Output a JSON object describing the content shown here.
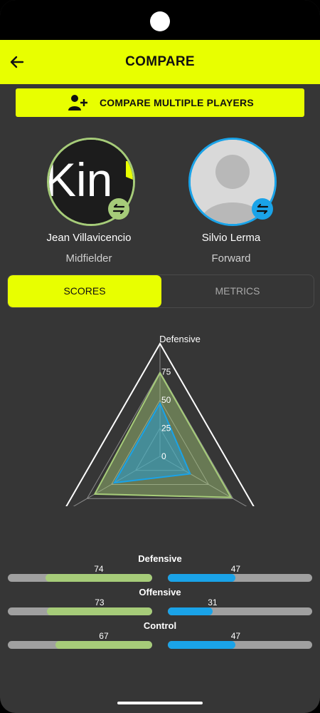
{
  "header": {
    "title": "COMPARE",
    "back_icon": "arrow-left-icon"
  },
  "compare_multiple": {
    "label": "COMPARE MULTIPLE PLAYERS",
    "icon": "add-person-icon"
  },
  "players": [
    {
      "name": "Jean Villavicencio",
      "position": "Midfielder",
      "avatar_text": "Kin",
      "color": "#a6cc79"
    },
    {
      "name": "Silvio Lerma",
      "position": "Forward",
      "color": "#1aa3e8"
    }
  ],
  "tabs": [
    {
      "label": "SCORES",
      "active": true
    },
    {
      "label": "METRICS",
      "active": false
    }
  ],
  "chart_data": {
    "type": "radar",
    "axes": [
      "Defensive",
      "Offensive",
      "Control"
    ],
    "rlim": [
      0,
      100
    ],
    "tick_labels": [
      "0",
      "25",
      "50",
      "75"
    ],
    "series": [
      {
        "values": [
          74,
          73,
          67
        ],
        "color": "#a6cc79"
      },
      {
        "values": [
          47,
          31,
          47
        ],
        "color": "#1aa3e8"
      }
    ]
  },
  "comparison": [
    {
      "label": "Defensive",
      "left": 74,
      "right": 47,
      "left_text": "74",
      "right_text": "47"
    },
    {
      "label": "Offensive",
      "left": 73,
      "right": 31,
      "left_text": "73",
      "right_text": "31"
    },
    {
      "label": "Control",
      "left": 67,
      "right": 47,
      "left_text": "67",
      "right_text": "47"
    }
  ],
  "colors": {
    "accent": "#e8ff00",
    "background": "#363636",
    "player1": "#a6cc79",
    "player2": "#1aa3e8"
  }
}
